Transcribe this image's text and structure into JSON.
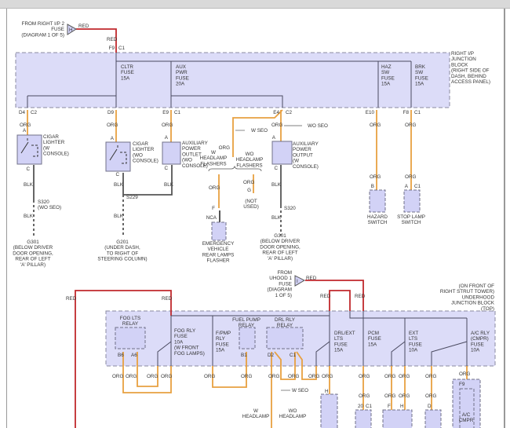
{
  "colors": {
    "wire_red": "#c0282c",
    "wire_org": "#e8a040",
    "wire_blk": "#555555",
    "bus": "#4a4a60",
    "block_fill": "#dcdcf8"
  },
  "wire": {
    "org": "ORG",
    "blk": "BLK",
    "red": "RED"
  },
  "connectors": {
    "from_right_ip2": {
      "letter": "H",
      "text": [
        "FROM RIGHT I/P 2",
        "FUSE",
        "(DIAGRAM 1 OF 5)"
      ]
    },
    "from_uhood1": {
      "letter": "I",
      "text": [
        "FROM",
        "UHOOD 1",
        "FUSE",
        "(DIAGRAM",
        "1 OF 5)"
      ]
    }
  },
  "right_ip_jb": {
    "label": [
      "RIGHT I/P",
      "JUNCTION",
      "BLOCK",
      "(RIGHT SIDE OF",
      "DASH, BEHIND",
      "ACCESS PANEL)"
    ],
    "fuses": {
      "cltr": [
        "CLTR",
        "FUSE",
        "15A"
      ],
      "aux_pwr": [
        "AUX",
        "PWR",
        "FUSE",
        "20A"
      ],
      "haz": [
        "HAZ",
        "SW",
        "FUSE",
        "15A"
      ],
      "brk": [
        "BRK",
        "SW",
        "FUSE",
        "15A"
      ]
    },
    "pins": {
      "f9": "F9",
      "c1": "C1",
      "d4": "D4",
      "c2": "C2",
      "d9": "D9",
      "e9": "E9",
      "e4": "E4",
      "e10": "E10",
      "f8": "F8"
    }
  },
  "components": {
    "cigar_w": [
      "CIGAR",
      "LIGHTER",
      "(W",
      "CONSOLE)"
    ],
    "cigar_wo": [
      "CIGAR",
      "LIGHTER",
      "(WO",
      "CONSOLE)"
    ],
    "aux_outlet_wo": [
      "AUXILIARY",
      "POWER",
      "OUTLET",
      "(WO",
      "CONSOLE)"
    ],
    "aux_output_w": [
      "AUXILIARY",
      "POWER",
      "OUTPUT",
      "(W",
      "CONSOLE)"
    ],
    "w_headlamp": [
      "W",
      "HEADLAMP",
      "FLASHERS"
    ],
    "wo_headlamp": [
      "WO",
      "HEADLAMP",
      "FLASHERS"
    ],
    "not_used": [
      "(NOT",
      "USED)"
    ],
    "emergency": [
      "EMERGENCY",
      "VEHICLE",
      "REAR LAMPS",
      "FLASHER"
    ],
    "hazard": [
      "HAZARD",
      "SWITCH"
    ],
    "stop_lamp": [
      "STOP LAMP",
      "SWITCH"
    ],
    "ac_cmpr": [
      "A/C",
      "CMPR"
    ]
  },
  "splices": {
    "s320_wo": [
      "S320",
      "(WO SEO)"
    ],
    "s229": "S229",
    "s320": "S320"
  },
  "grounds": {
    "g301_a": [
      "G301",
      "(BELOW DRIVER",
      "DOOR OPENING,",
      "REAR OF LEFT",
      "'A' PILLAR)"
    ],
    "g201": [
      "G201",
      "(UNDER DASH,",
      "TO RIGHT OF",
      "STEERING COLUMN)"
    ],
    "g301_b": [
      "G301",
      "(BELOW DRIVER",
      "DOOR OPENING,",
      "REAR OF LEFT",
      "'A' PILLAR)"
    ]
  },
  "options": {
    "w_seo": "W SEO",
    "wo_seo": "WO SEO"
  },
  "pins": {
    "a": "A",
    "b": "B",
    "c": "C",
    "d": "D",
    "f": "F",
    "g": "G",
    "h": "H",
    "nca": "NCA",
    "c1": "C1",
    "b6": "B6",
    "a6": "A6",
    "b1": "B1",
    "d2": "D2",
    "p20": "20",
    "f9": "F9"
  },
  "underhood_jb": {
    "label": [
      "(ON FRONT OF",
      "RIGHT STRUT TOWER)",
      "UNDERHOOD",
      "JUNCTION BLOCK",
      "(TOP)"
    ],
    "relays": {
      "fog_lts": [
        "FOG LTS",
        "RELAY"
      ],
      "fuel_pump": [
        "FUEL PUMP",
        "RELAY"
      ],
      "drl": [
        "DRL RLY",
        "RELAY"
      ]
    },
    "fuses": {
      "fog_rly": [
        "FOG RLY",
        "FUSE",
        "10A",
        "(W FRONT",
        "FOG LAMPS)"
      ],
      "fpmp": [
        "F/PMP",
        "RLY",
        "FUSE",
        "15A"
      ],
      "drl_ext": [
        "DRL/EXT",
        "LTS",
        "FUSE",
        "15A"
      ],
      "pcm": [
        "PCM",
        "FUSE",
        "15A"
      ],
      "ext_lts": [
        "EXT",
        "LTS",
        "FUSE",
        "10A"
      ],
      "ac_rly": [
        "A/C RLY",
        "(CMPR)",
        "FUSE",
        "10A"
      ]
    }
  },
  "bottom_labels": {
    "w_headlamp": [
      "W",
      "HEADLAMP"
    ],
    "wo_headlamp": [
      "WO",
      "HEADLAMP"
    ]
  }
}
